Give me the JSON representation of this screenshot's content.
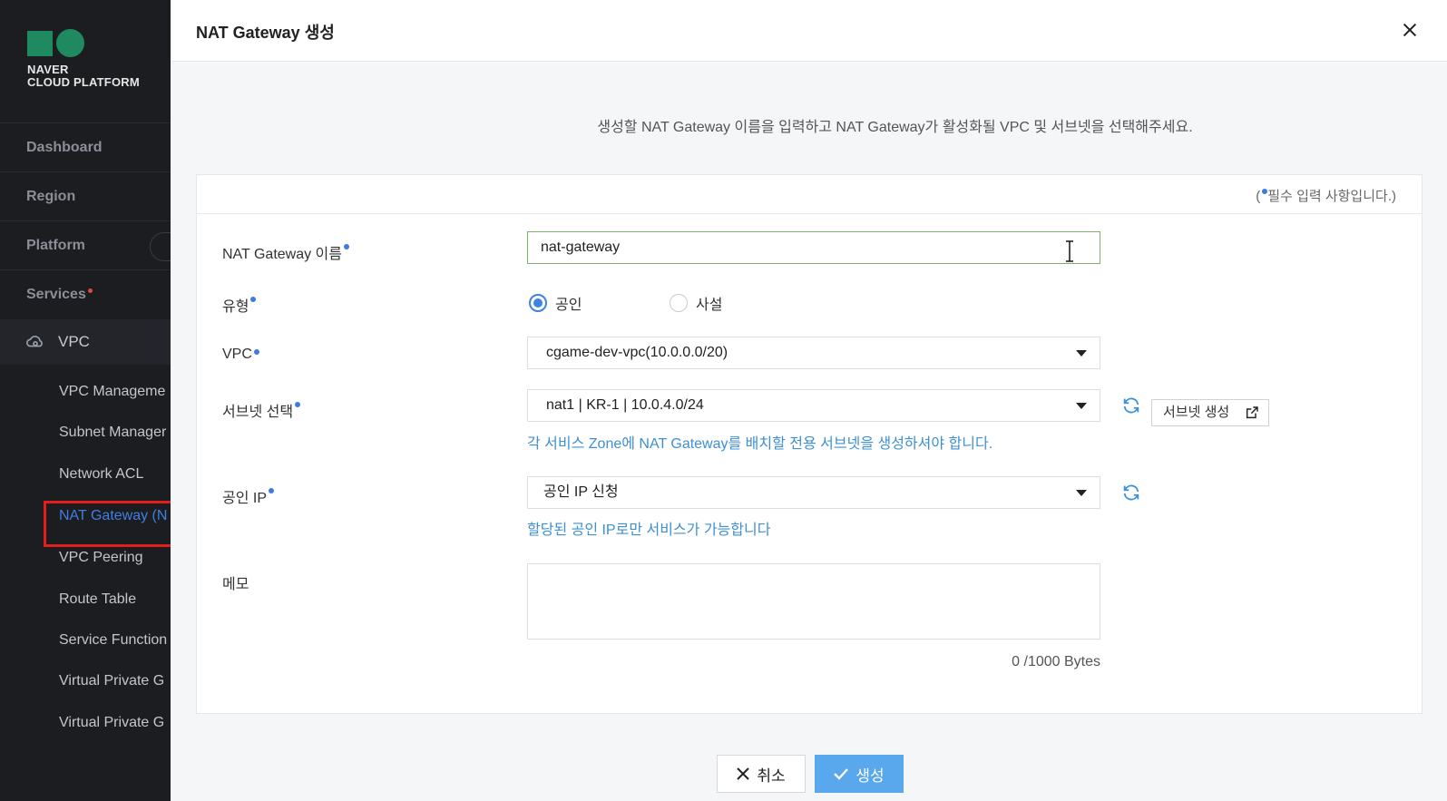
{
  "sidebar": {
    "logo_line1": "NAVER",
    "logo_line2": "CLOUD PLATFORM",
    "sections": [
      {
        "label": "Dashboard"
      },
      {
        "label": "Region"
      },
      {
        "label": "Platform"
      },
      {
        "label": "Services"
      }
    ],
    "vpc_label": "VPC",
    "sub_items": [
      {
        "label": "VPC Manageme"
      },
      {
        "label": "Subnet Manager"
      },
      {
        "label": "Network ACL"
      },
      {
        "label": "NAT Gateway (N"
      },
      {
        "label": "VPC Peering"
      },
      {
        "label": "Route Table"
      },
      {
        "label": "Service Function"
      },
      {
        "label": "Virtual Private G"
      },
      {
        "label": "Virtual Private G"
      }
    ]
  },
  "modal": {
    "title": "NAT Gateway 생성",
    "intro": "생성할 NAT Gateway 이름을 입력하고 NAT Gateway가 활성화될 VPC 및 서브넷을 선택해주세요.",
    "required_note_prefix": "(",
    "required_note_suffix": "필수 입력 사항입니다.)",
    "fields": {
      "name_label": "NAT Gateway 이름",
      "name_value": "nat-gateway",
      "type_label": "유형",
      "type_options": [
        "공인",
        "사설"
      ],
      "type_selected": "공인",
      "vpc_label": "VPC",
      "vpc_value": "cgame-dev-vpc(10.0.0.0/20)",
      "subnet_label": "서브넷 선택",
      "subnet_value": "nat1 | KR-1 | 10.0.4.0/24",
      "subnet_create_button": "서브넷 생성",
      "subnet_helper": "각 서비스 Zone에 NAT Gateway를 배치할 전용 서브넷을 생성하셔야 합니다.",
      "public_ip_label": "공인 IP",
      "public_ip_value": "공인 IP 신청",
      "public_ip_helper": "할당된 공인 IP로만 서비스가 가능합니다",
      "memo_label": "메모",
      "memo_value": "",
      "memo_bytes": "0 /1000 Bytes"
    },
    "buttons": {
      "cancel": "취소",
      "create": "생성"
    }
  },
  "colors": {
    "accent": "#3c84e0",
    "create_button": "#59a7ec",
    "helper_text": "#3d8fd6",
    "highlight": "#e51c1c",
    "logo": "#1f8a60"
  },
  "icons": [
    "close-icon",
    "refresh-icon",
    "external-link-icon",
    "vpc-cloud-icon",
    "check-icon",
    "x-icon",
    "text-cursor-icon"
  ]
}
